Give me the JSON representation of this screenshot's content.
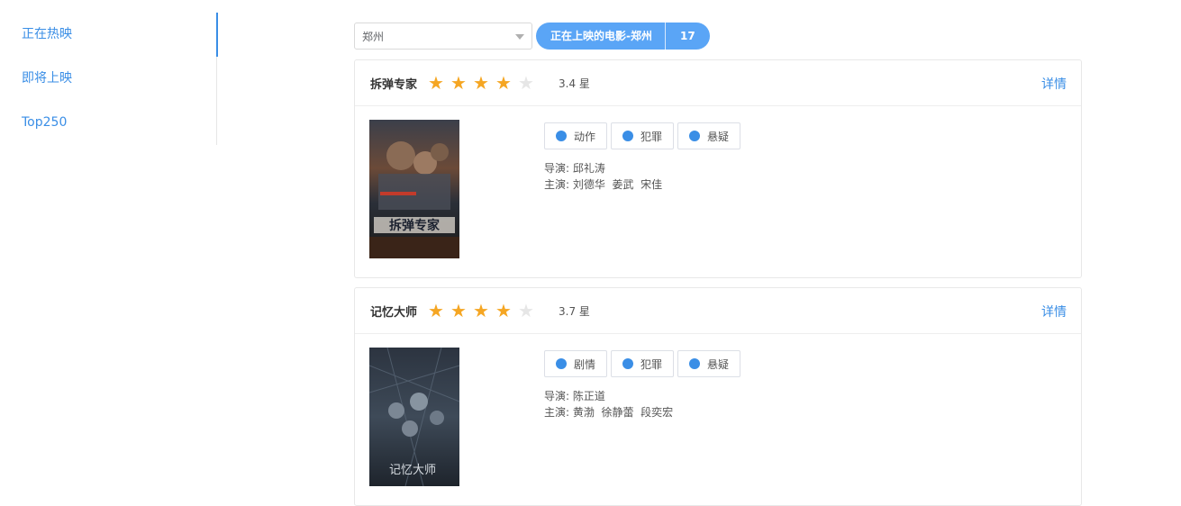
{
  "sidebar": {
    "items": [
      {
        "label": "正在热映"
      },
      {
        "label": "即将上映"
      },
      {
        "label": "Top250"
      }
    ]
  },
  "toolbar": {
    "city_select_value": "郑州",
    "now_showing_label": "正在上映的电影-郑州",
    "count": "17"
  },
  "movies": [
    {
      "title": "拆弹专家",
      "stars": 3.5,
      "rating": "3.4 星",
      "detail_label": "详情",
      "genres": [
        "动作",
        "犯罪",
        "悬疑"
      ],
      "director_label": "导演:",
      "director": "邱礼涛",
      "cast_label": "主演:",
      "cast": "刘德华  姜武  宋佳",
      "poster_text": "拆弹专家"
    },
    {
      "title": "记忆大师",
      "stars": 3.5,
      "rating": "3.7 星",
      "detail_label": "详情",
      "genres": [
        "剧情",
        "犯罪",
        "悬疑"
      ],
      "director_label": "导演:",
      "director": "陈正道",
      "cast_label": "主演:",
      "cast": "黄渤  徐静蕾  段奕宏",
      "poster_text": "记忆大师"
    }
  ],
  "colors": {
    "accent": "#3a8ee6",
    "pill": "#5aa5f6",
    "star_on": "#f5a623",
    "star_off": "#e6e6e6"
  }
}
